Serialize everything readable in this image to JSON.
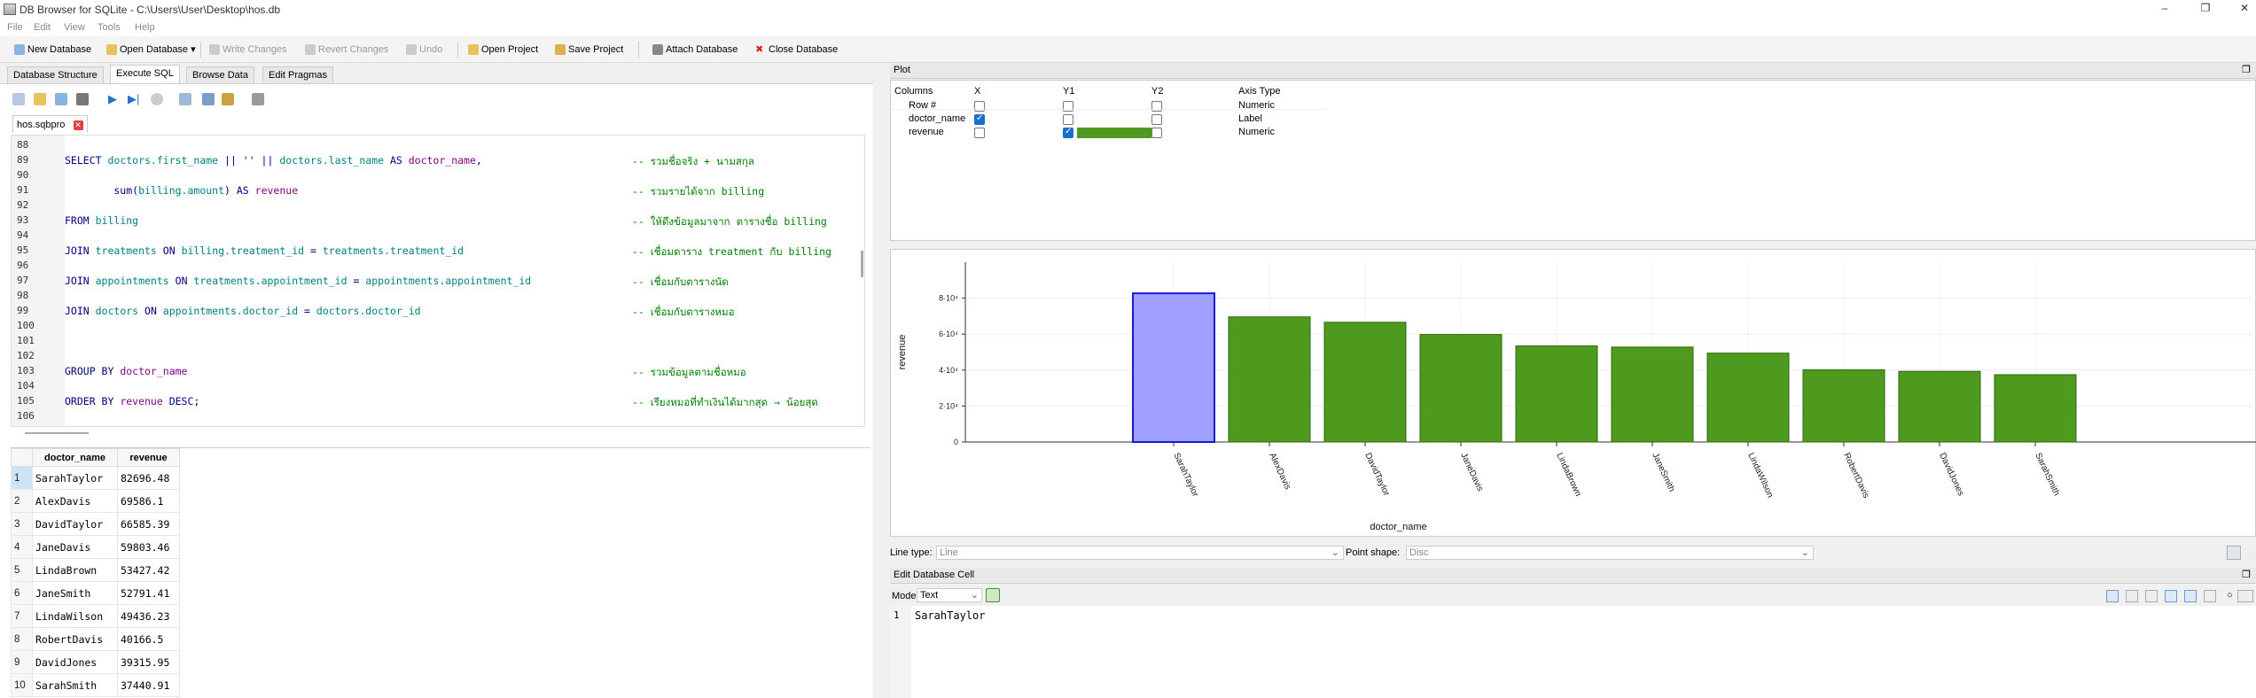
{
  "window": {
    "title": "DB Browser for SQLite - C:\\Users\\User\\Desktop\\hos.db"
  },
  "menu": [
    "File",
    "Edit",
    "View",
    "Tools",
    "Help"
  ],
  "toolbar": {
    "new_db": "New Database",
    "open_db": "Open Database",
    "write": "Write Changes",
    "revert": "Revert Changes",
    "undo": "Undo",
    "open_proj": "Open Project",
    "save_proj": "Save Project",
    "attach": "Attach Database",
    "close": "Close Database"
  },
  "tabs": [
    "Database Structure",
    "Execute SQL",
    "Browse Data",
    "Edit Pragmas"
  ],
  "editor": {
    "file_tab": "hos.sqbpro",
    "lines": [
      {
        "n": "88",
        "parts": []
      },
      {
        "n": "89",
        "parts": [
          [
            "kw",
            "SELECT "
          ],
          [
            "fn",
            "doctors.first_name"
          ],
          [
            "kw",
            " || '' || "
          ],
          [
            "fn",
            "doctors.last_name"
          ],
          [
            "kw",
            " AS "
          ],
          [
            "id",
            "doctor_name"
          ],
          [
            "kw",
            ","
          ]
        ],
        "comment": "-- รวมชื่อจริง + นามสกุล"
      },
      {
        "n": "90",
        "parts": []
      },
      {
        "n": "91",
        "parts": [
          [
            "kw",
            "        sum("
          ],
          [
            "fn",
            "billing.amount"
          ],
          [
            "kw",
            ") AS "
          ],
          [
            "id",
            "revenue"
          ]
        ],
        "comment": "-- รวมรายได้จาก billing"
      },
      {
        "n": "92",
        "parts": []
      },
      {
        "n": "93",
        "parts": [
          [
            "kw",
            "FROM "
          ],
          [
            "fn",
            "billing"
          ]
        ],
        "comment": "-- ให้ดึงข้อมูลมาจาก ตารางชื่อ billing"
      },
      {
        "n": "94",
        "parts": []
      },
      {
        "n": "95",
        "parts": [
          [
            "kw",
            "JOIN "
          ],
          [
            "fn",
            "treatments"
          ],
          [
            "kw",
            " ON "
          ],
          [
            "fn",
            "billing.treatment_id"
          ],
          [
            "kw",
            " = "
          ],
          [
            "fn",
            "treatments.treatment_id"
          ]
        ],
        "comment": "-- เชื่อมตาราง treatment กับ billing"
      },
      {
        "n": "96",
        "parts": []
      },
      {
        "n": "97",
        "parts": [
          [
            "kw",
            "JOIN "
          ],
          [
            "fn",
            "appointments"
          ],
          [
            "kw",
            " ON "
          ],
          [
            "fn",
            "treatments.appointment_id"
          ],
          [
            "kw",
            " = "
          ],
          [
            "fn",
            "appointments.appointment_id"
          ]
        ],
        "comment": "-- เชื่อมกับตารางนัด"
      },
      {
        "n": "98",
        "parts": []
      },
      {
        "n": "99",
        "parts": [
          [
            "kw",
            "JOIN "
          ],
          [
            "fn",
            "doctors"
          ],
          [
            "kw",
            " ON "
          ],
          [
            "fn",
            "appointments.doctor_id"
          ],
          [
            "kw",
            " = "
          ],
          [
            "fn",
            "doctors.doctor_id"
          ]
        ],
        "comment": "-- เชื่อมกับตารางหมอ"
      },
      {
        "n": "100",
        "parts": []
      },
      {
        "n": "101",
        "parts": []
      },
      {
        "n": "102",
        "parts": []
      },
      {
        "n": "103",
        "parts": [
          [
            "kw",
            "GROUP BY "
          ],
          [
            "id",
            "doctor_name"
          ]
        ],
        "comment": "-- รวมข้อมูลตามชื่อหมอ"
      },
      {
        "n": "104",
        "parts": []
      },
      {
        "n": "105",
        "parts": [
          [
            "kw",
            "ORDER BY "
          ],
          [
            "id",
            "revenue"
          ],
          [
            "kw",
            " DESC;"
          ]
        ],
        "comment": "-- เรียงหมอที่ทำเงินได้มากสุด → น้อยสุด"
      },
      {
        "n": "106",
        "parts": []
      }
    ]
  },
  "results": {
    "headers": [
      "doctor_name",
      "revenue"
    ],
    "rows": [
      [
        "1",
        "SarahTaylor",
        "82696.48"
      ],
      [
        "2",
        "AlexDavis",
        "69586.1"
      ],
      [
        "3",
        "DavidTaylor",
        "66585.39"
      ],
      [
        "4",
        "JaneDavis",
        "59803.46"
      ],
      [
        "5",
        "LindaBrown",
        "53427.42"
      ],
      [
        "6",
        "JaneSmith",
        "52791.41"
      ],
      [
        "7",
        "LindaWilson",
        "49436.23"
      ],
      [
        "8",
        "RobertDavis",
        "40166.5"
      ],
      [
        "9",
        "DavidJones",
        "39315.95"
      ],
      [
        "10",
        "SarahSmith",
        "37440.91"
      ]
    ]
  },
  "plot": {
    "title": "Plot",
    "columns_headers": [
      "Columns",
      "X",
      "Y1",
      "Y2",
      "Axis Type"
    ],
    "columns_rows": [
      {
        "name": "Row #",
        "x": false,
        "y1": false,
        "y2": false,
        "type": "Numeric"
      },
      {
        "name": "doctor_name",
        "x": true,
        "y1": false,
        "y2": false,
        "type": "Label"
      },
      {
        "name": "revenue",
        "x": false,
        "y1": true,
        "y2": false,
        "type": "Numeric"
      }
    ],
    "y1_color": "#4e9a1e",
    "line_type_label": "Line type:",
    "line_type_value": "Line",
    "point_shape_label": "Point shape:",
    "point_shape_value": "Disc"
  },
  "chart_data": {
    "type": "bar",
    "categories": [
      "SarahTaylor",
      "AlexDavis",
      "DavidTaylor",
      "JaneDavis",
      "LindaBrown",
      "JaneSmith",
      "LindaWilson",
      "RobertDavis",
      "DavidJones",
      "SarahSmith"
    ],
    "values": [
      82696.48,
      69586.1,
      66585.39,
      59803.46,
      53427.42,
      52791.41,
      49436.23,
      40166.5,
      39315.95,
      37440.91
    ],
    "xlabel": "doctor_name",
    "ylabel": "revenue",
    "yticks": [
      "0",
      "2·10⁴",
      "4·10⁴",
      "6·10⁴",
      "8·10⁴"
    ],
    "ylim": [
      0,
      100000
    ],
    "selected_index": 0,
    "bar_color": "#4e9a1e",
    "selected_color": "#a0a0ff",
    "grid": true
  },
  "edit_cell": {
    "title": "Edit Database Cell",
    "mode_label": "Mode:",
    "mode_value": "Text",
    "line_no": "1",
    "value": "SarahTaylor"
  }
}
